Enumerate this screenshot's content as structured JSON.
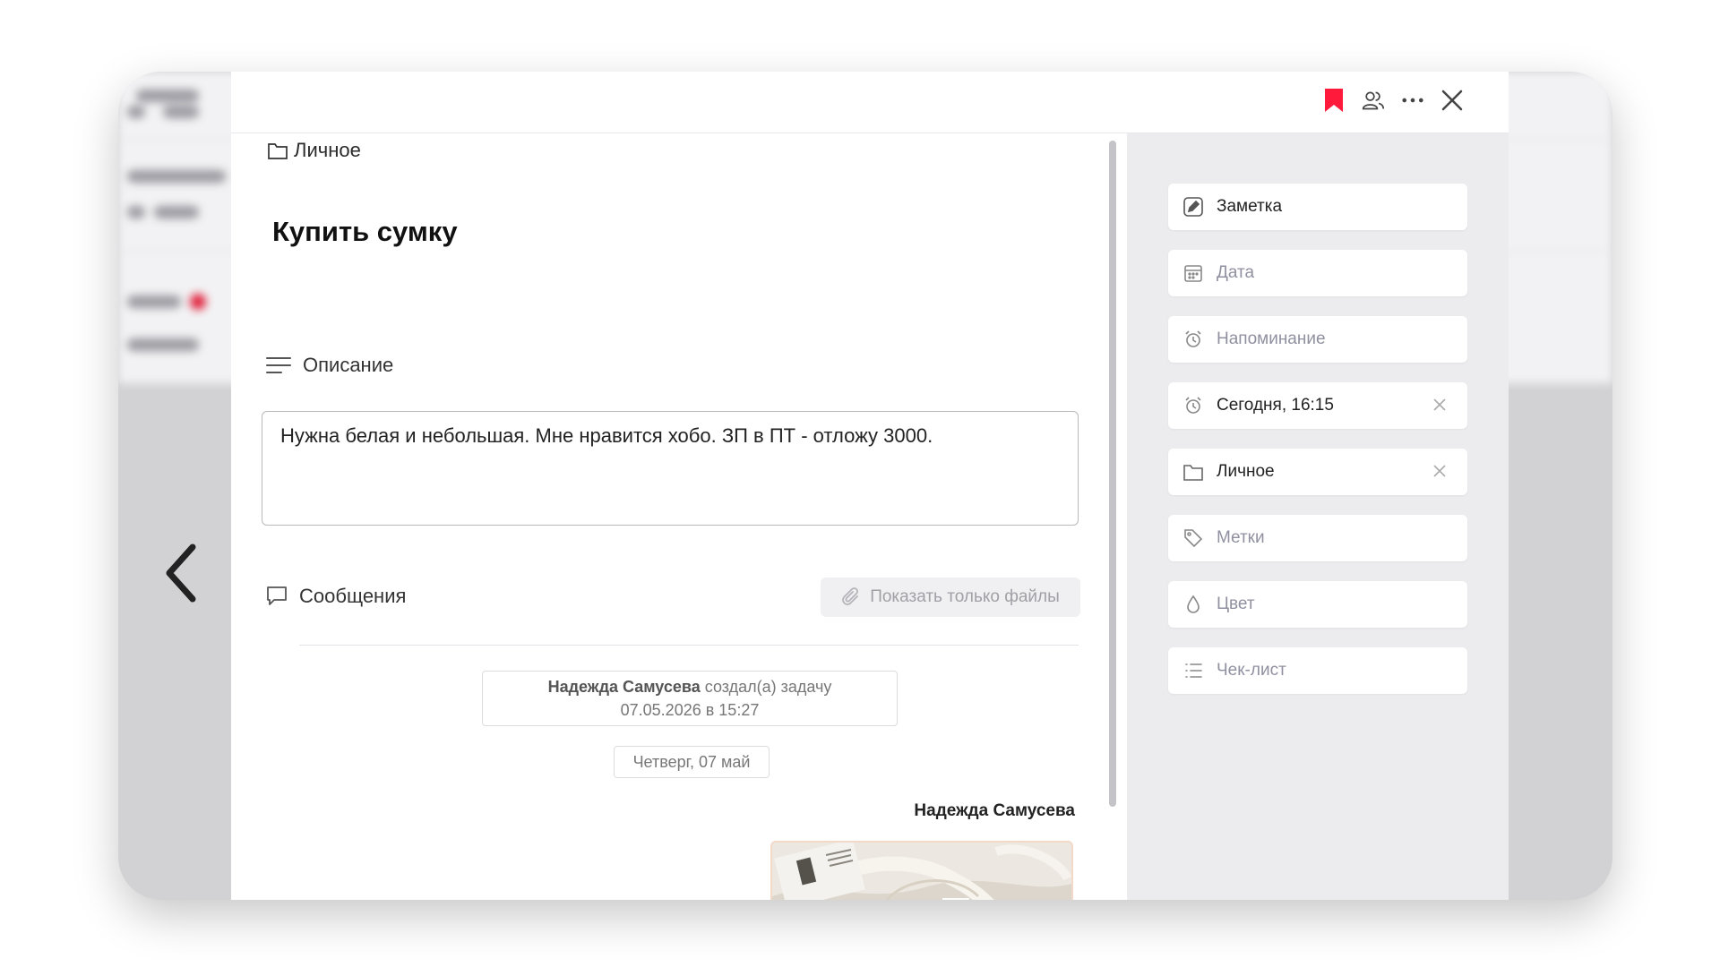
{
  "breadcrumb": {
    "folder": "Личное"
  },
  "task": {
    "title": "Купить сумку"
  },
  "description": {
    "heading": "Описание",
    "text": "Нужна белая и небольшая. Мне нравится хобо. ЗП в ПТ - отложу 3000."
  },
  "messages": {
    "heading": "Сообщения",
    "files_button": "Показать только файлы",
    "system_author": "Надежда Самусева",
    "system_action": "создал(а) задачу",
    "system_datetime": "07.05.2026 в 15:27",
    "day_label": "Четверг, 07 май",
    "author": "Надежда Самусева",
    "attachment_icon": "photo-of-white-bag"
  },
  "sidebar": {
    "note": "Заметка",
    "date": "Дата",
    "reminder": "Напоминание",
    "reminder_value": "Сегодня, 16:15",
    "folder_value": "Личное",
    "tags": "Метки",
    "color": "Цвет",
    "checklist": "Чек-лист"
  },
  "colors": {
    "bookmark": "#ff1a3c",
    "panel_bg": "#ececef",
    "accent_dot": "#e0203a"
  }
}
